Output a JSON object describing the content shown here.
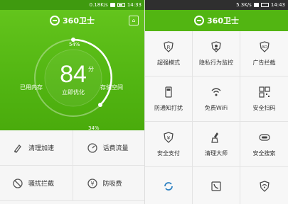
{
  "left": {
    "status": {
      "speed": "0.18K/s",
      "time": "14:33"
    },
    "app_title": "360卫士",
    "skin_icon": "shirt-icon",
    "score": {
      "value": "84",
      "unit": "分",
      "action": "立即优化"
    },
    "memory": {
      "label": "已用内存",
      "percent": "54%",
      "fill": 0.54
    },
    "storage": {
      "label": "存储空间",
      "percent": "34%",
      "fill": 0.34
    },
    "features": [
      {
        "label": "清理加速",
        "icon": "broom-icon"
      },
      {
        "label": "话费流量",
        "icon": "meter-icon"
      },
      {
        "label": "骚扰拦截",
        "icon": "block-icon"
      },
      {
        "label": "防吸费",
        "icon": "coin-shield-icon"
      }
    ]
  },
  "right": {
    "status": {
      "speed": "5.3K/s",
      "time": "14:43"
    },
    "app_title": "360卫士",
    "tiles": [
      {
        "label": "超强模式",
        "icon": "r-shield-icon"
      },
      {
        "label": "隐私行为监控",
        "icon": "person-shield-icon"
      },
      {
        "label": "广告拦截",
        "icon": "ad-shield-icon"
      },
      {
        "label": "防通知打扰",
        "icon": "notify-phone-icon"
      },
      {
        "label": "免费WiFi",
        "icon": "wifi-icon"
      },
      {
        "label": "安全扫码",
        "icon": "qr-code-icon"
      },
      {
        "label": "安全支付",
        "icon": "yen-shield-icon"
      },
      {
        "label": "清理大师",
        "icon": "broom-icon"
      },
      {
        "label": "安全搜索",
        "icon": "search-pill-icon"
      },
      {
        "label": "",
        "icon": "refresh-icon"
      },
      {
        "label": "",
        "icon": "phone-icon"
      },
      {
        "label": "",
        "icon": "wifi-shield-icon"
      }
    ]
  },
  "colors": {
    "brand_green": "#52b512",
    "dark_status": "#2f2f2f"
  }
}
